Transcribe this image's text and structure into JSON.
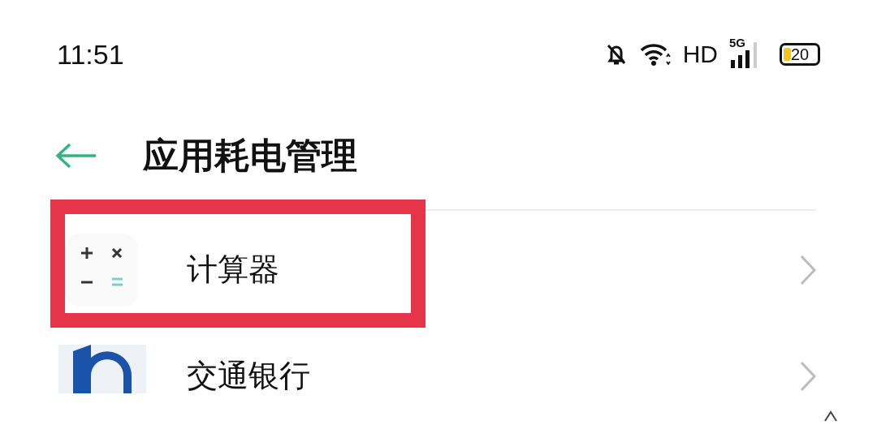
{
  "status_bar": {
    "time": "11:51",
    "network": "HD",
    "cellular": "5G",
    "battery": {
      "text": "20",
      "level": 0.2
    }
  },
  "header": {
    "title": "应用耗电管理"
  },
  "apps": [
    {
      "name": "计算器",
      "kind": "calculator",
      "highlighted": true
    },
    {
      "name": "交通银行",
      "kind": "bank",
      "highlighted": false
    }
  ]
}
